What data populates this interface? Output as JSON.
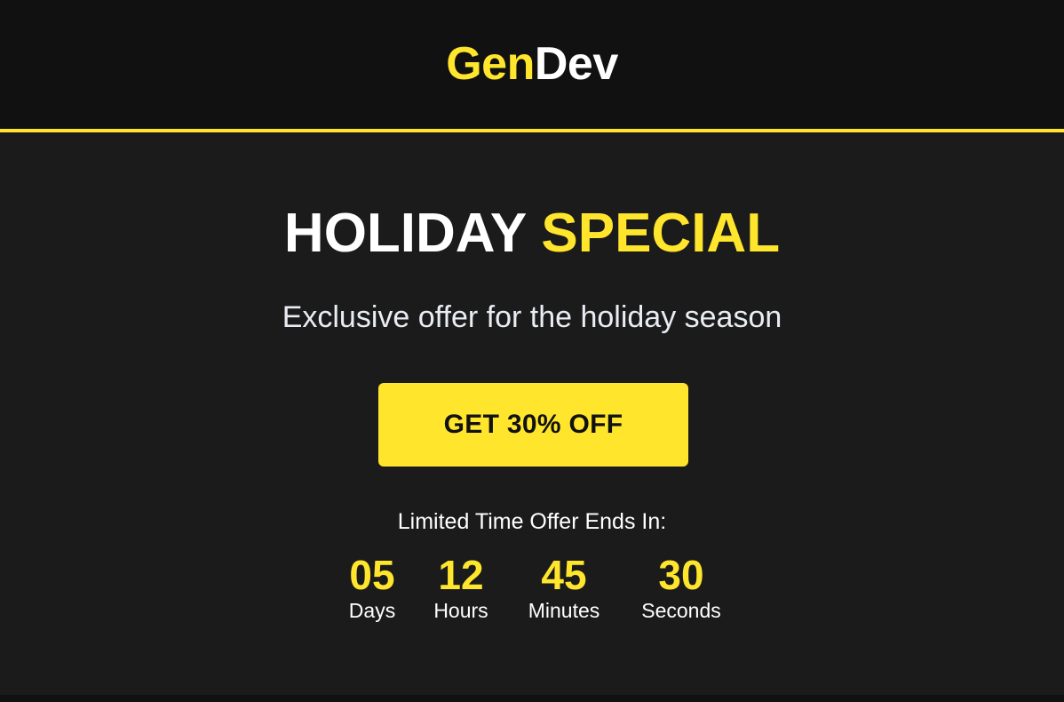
{
  "header": {
    "logo_accent": "Gen",
    "logo_rest": "Dev"
  },
  "hero": {
    "title_main": "HOLIDAY",
    "title_accent": "SPECIAL",
    "subtitle": "Exclusive offer for the holiday season",
    "cta_label": "GET 30% OFF"
  },
  "countdown": {
    "label": "Limited Time Offer Ends In:",
    "units": [
      {
        "value": "05",
        "label": "Days"
      },
      {
        "value": "12",
        "label": "Hours"
      },
      {
        "value": "45",
        "label": "Minutes"
      },
      {
        "value": "30",
        "label": "Seconds"
      }
    ]
  },
  "colors": {
    "accent": "#ffe62c",
    "header_bg": "#111111",
    "hero_bg": "#1b1b1b",
    "text": "#ffffff"
  }
}
